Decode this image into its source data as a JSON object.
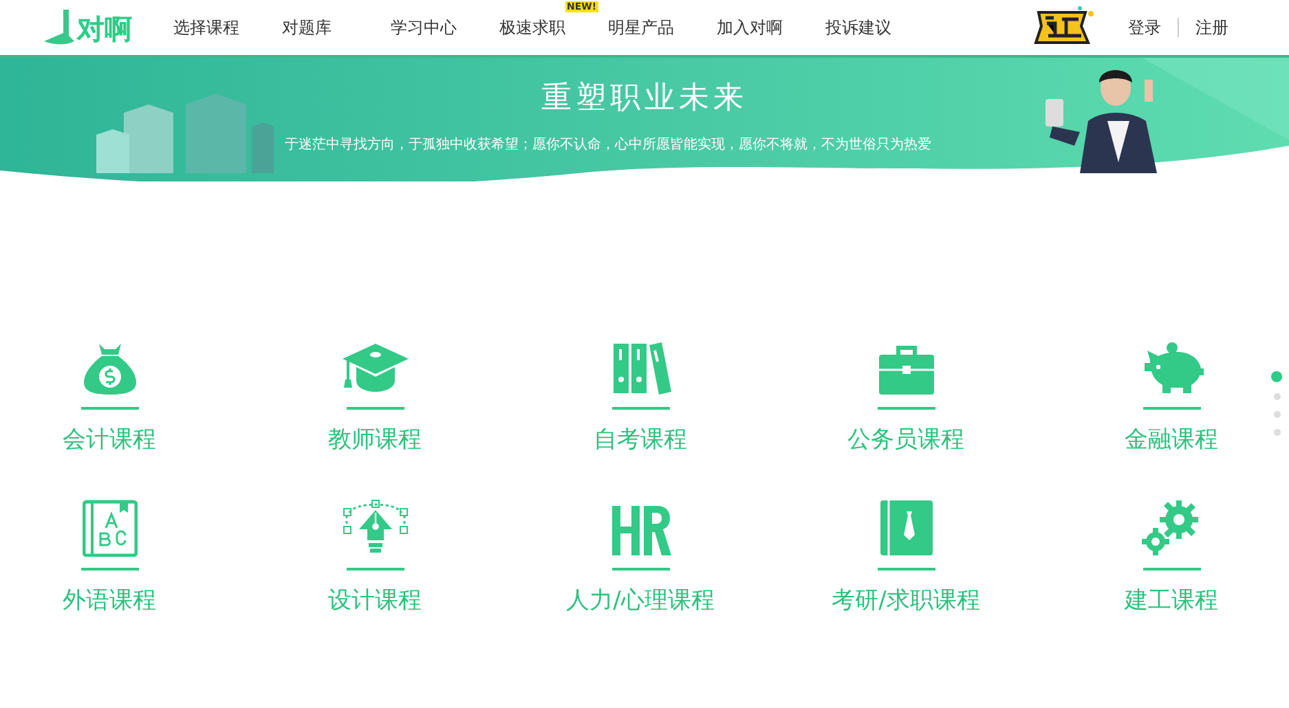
{
  "header": {
    "logo": "对啊",
    "nav": [
      {
        "label": "选择课程"
      },
      {
        "label": "对题库"
      },
      {
        "label": "学习中心"
      },
      {
        "label": "极速求职",
        "badge": "NEW!"
      },
      {
        "label": "明星产品"
      },
      {
        "label": "加入对啊"
      },
      {
        "label": "投诉建议"
      }
    ],
    "login": "登录",
    "register": "注册"
  },
  "banner": {
    "title": "重塑职业未来",
    "subtitle": "于迷茫中寻找方向，于孤独中收获希望；愿你不认命，心中所愿皆能实现，愿你不将就，不为世俗只为热爱"
  },
  "courses": [
    {
      "kind": "money",
      "label": "会计课程"
    },
    {
      "kind": "cap",
      "label": "教师课程"
    },
    {
      "kind": "books",
      "label": "自考课程"
    },
    {
      "kind": "briefcase",
      "label": "公务员课程"
    },
    {
      "kind": "piggy",
      "label": "金融课程"
    },
    {
      "kind": "abc",
      "label": "外语课程"
    },
    {
      "kind": "pen",
      "label": "设计课程"
    },
    {
      "kind": "hr",
      "label": "人力/心理课程"
    },
    {
      "kind": "tie",
      "label": "考研/求职课程"
    },
    {
      "kind": "gears",
      "label": "建工课程"
    }
  ],
  "pager": [
    {
      "selected": true
    },
    {
      "selected": false
    },
    {
      "selected": false
    },
    {
      "selected": false
    }
  ]
}
